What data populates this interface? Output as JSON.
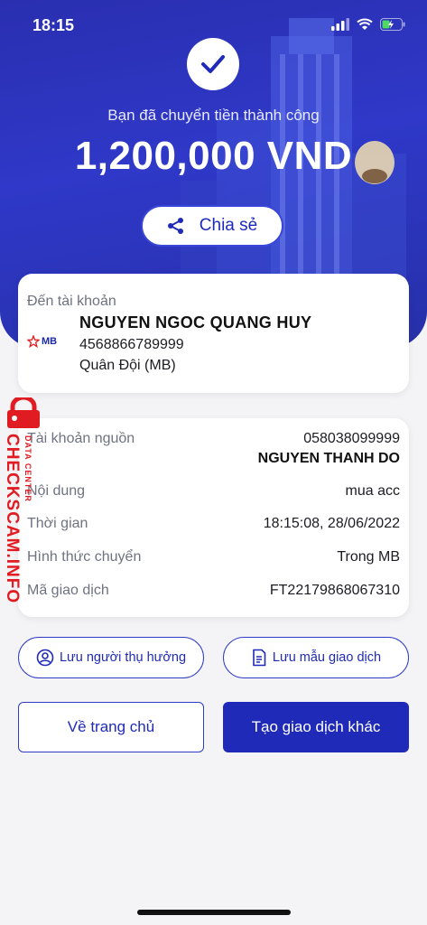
{
  "status": {
    "time": "18:15"
  },
  "hero": {
    "success_text": "Bạn đã chuyển tiền thành công",
    "amount": "1,200,000 VND",
    "share_label": "Chia sẻ"
  },
  "recipient": {
    "to_label": "Đến tài khoản",
    "bank_logo": "MB",
    "name": "NGUYEN NGOC QUANG HUY",
    "account": "4568866789999",
    "bank": "Quân Đội (MB)"
  },
  "details": {
    "source_label": "Tài khoản nguồn",
    "source_account": "058038099999",
    "source_name": "NGUYEN THANH DO",
    "content_label": "Nội dung",
    "content_value": "mua acc",
    "time_label": "Thời gian",
    "time_value": "18:15:08, 28/06/2022",
    "method_label": "Hình thức chuyển",
    "method_value": "Trong MB",
    "txn_label": "Mã giao dịch",
    "txn_value": "FT22179868067310"
  },
  "actions": {
    "save_beneficiary": "Lưu người thụ hưởng",
    "save_template": "Lưu mẫu giao dịch",
    "home": "Về trang chủ",
    "new_transaction": "Tạo giao dịch khác"
  },
  "watermark": {
    "main": "CHECKSCAM.INFO",
    "sub": "DATA CENTER"
  },
  "colors": {
    "brand": "#1f2bb8",
    "hero": "#2f38c8",
    "watermark": "#e11b22"
  }
}
